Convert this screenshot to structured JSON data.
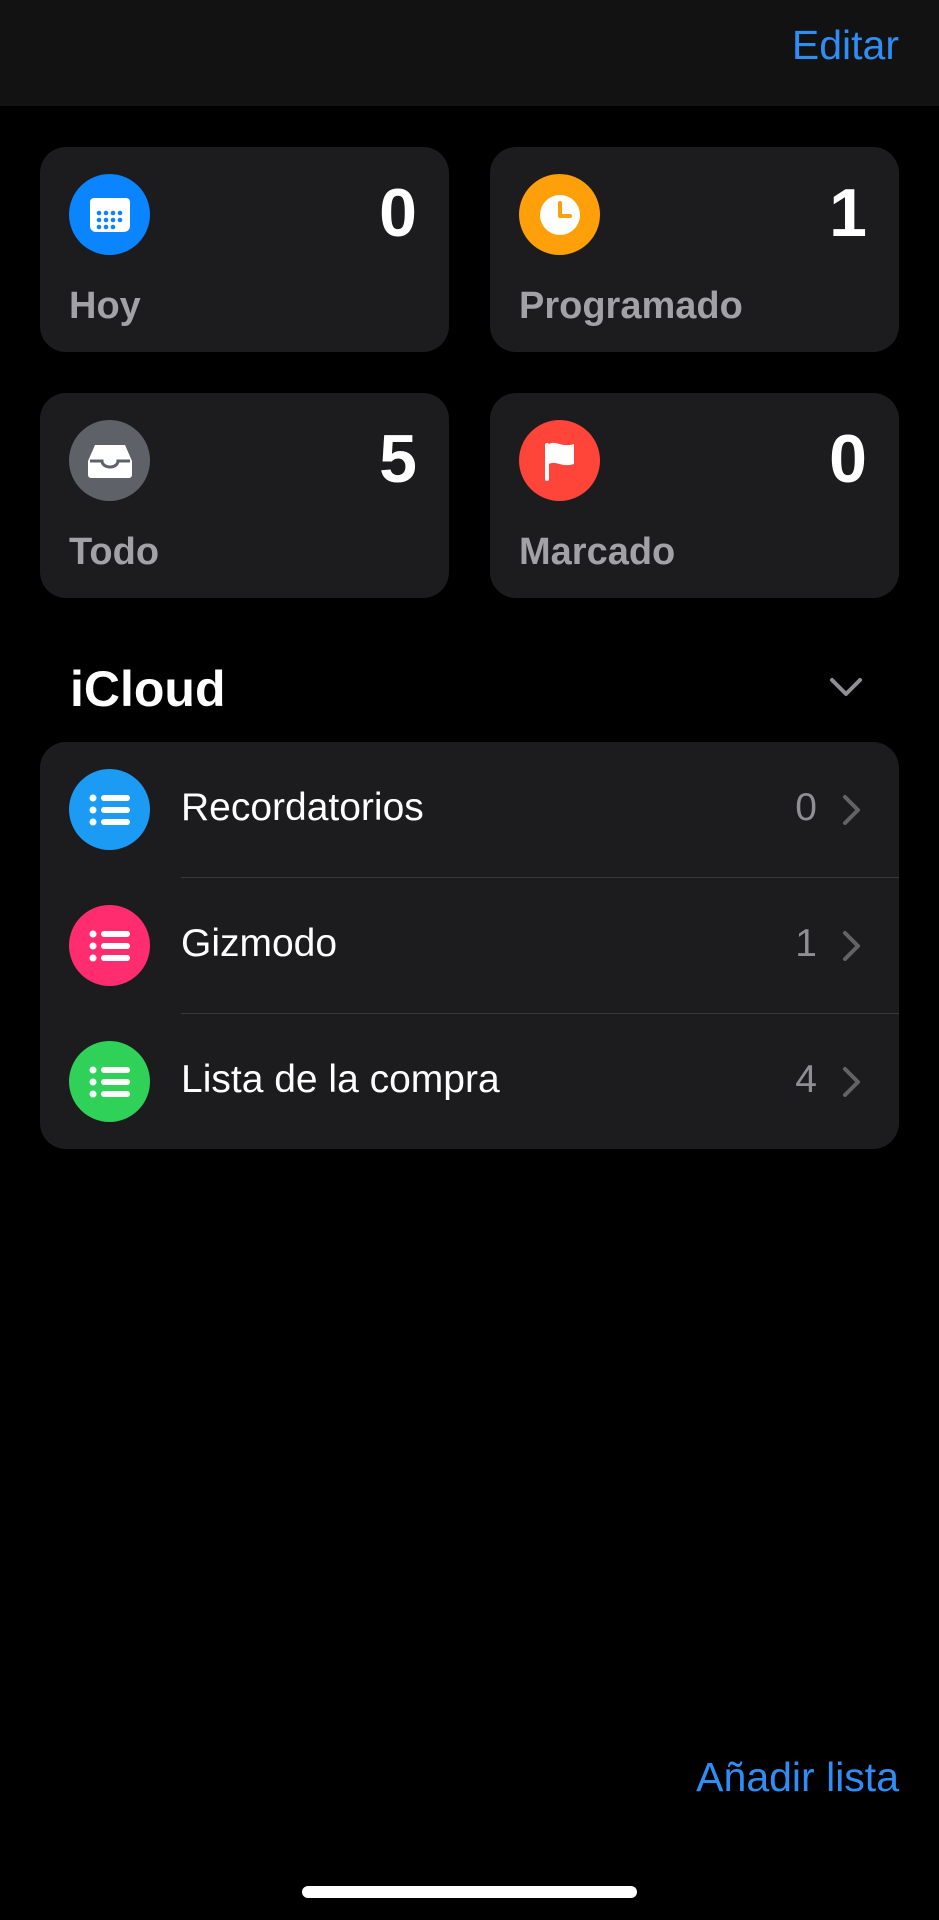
{
  "header": {
    "edit_label": "Editar"
  },
  "smart_lists": [
    {
      "label": "Hoy",
      "count": "0",
      "icon": "calendar-icon",
      "color": "#0a84ff"
    },
    {
      "label": "Programado",
      "count": "1",
      "icon": "clock-icon",
      "color": "#ff9f0a"
    },
    {
      "label": "Todo",
      "count": "5",
      "icon": "tray-icon",
      "color": "#5e6268"
    },
    {
      "label": "Marcado",
      "count": "0",
      "icon": "flag-icon",
      "color": "#ff453a"
    }
  ],
  "icloud": {
    "title": "iCloud",
    "lists": [
      {
        "name": "Recordatorios",
        "count": "0",
        "color": "#1c9bf5"
      },
      {
        "name": "Gizmodo",
        "count": "1",
        "color": "#ff2d6f"
      },
      {
        "name": "Lista de la compra",
        "count": "4",
        "color": "#30d158"
      }
    ]
  },
  "footer": {
    "add_list_label": "Añadir lista"
  }
}
